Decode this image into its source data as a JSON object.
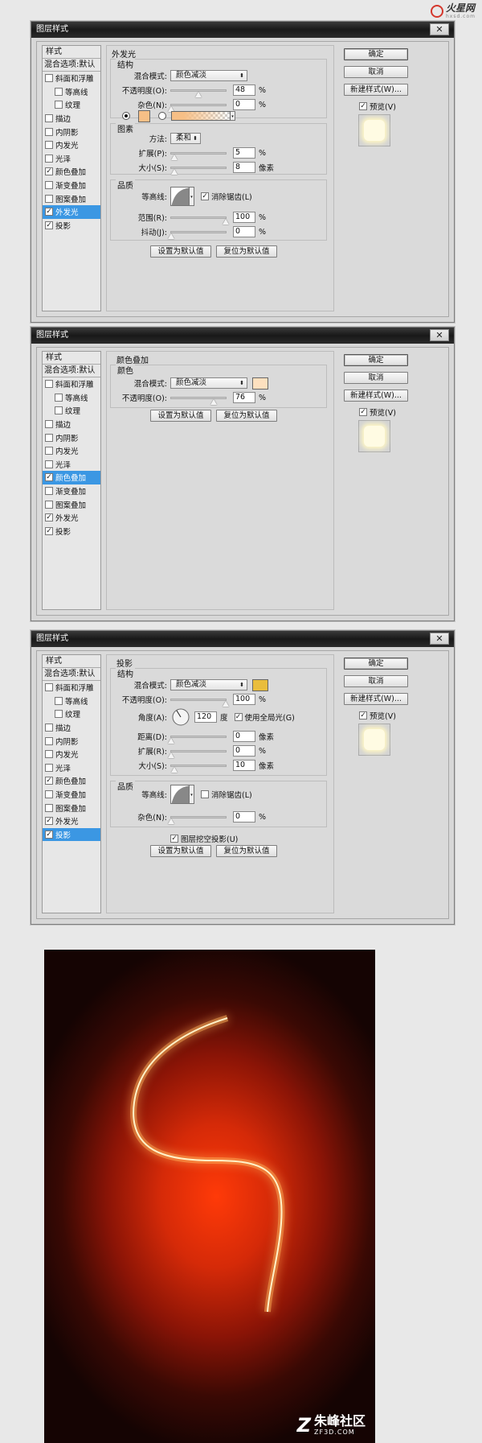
{
  "watermark_top": {
    "name": "火星网",
    "sub": "hxsd.com"
  },
  "dialog1": {
    "title": "图层样式",
    "styles_header": "样式",
    "blend_label": "混合选项:默认",
    "items": [
      {
        "label": "斜面和浮雕",
        "checked": false
      },
      {
        "label": "等高线",
        "checked": false,
        "indent": true
      },
      {
        "label": "纹理",
        "checked": false,
        "indent": true
      },
      {
        "label": "描边",
        "checked": false
      },
      {
        "label": "内阴影",
        "checked": false
      },
      {
        "label": "内发光",
        "checked": false
      },
      {
        "label": "光泽",
        "checked": false
      },
      {
        "label": "颜色叠加",
        "checked": true
      },
      {
        "label": "渐变叠加",
        "checked": false
      },
      {
        "label": "图案叠加",
        "checked": false
      },
      {
        "label": "外发光",
        "checked": true,
        "active": true
      },
      {
        "label": "投影",
        "checked": true
      }
    ],
    "panel_title": "外发光",
    "structure": {
      "title": "结构",
      "blend_mode_label": "混合模式:",
      "blend_mode_value": "颜色减淡",
      "opacity_label": "不透明度(O):",
      "opacity_value": "48",
      "noise_label": "杂色(N):",
      "noise_value": "0",
      "percent": "%",
      "color": "#f7bf86"
    },
    "elements": {
      "title": "图素",
      "method_label": "方法:",
      "method_value": "柔和",
      "spread_label": "扩展(P):",
      "spread_value": "5",
      "size_label": "大小(S):",
      "size_value": "8",
      "percent": "%",
      "px": "像素"
    },
    "quality": {
      "title": "品质",
      "contour_label": "等高线:",
      "antialias_label": "消除锯齿(L)",
      "range_label": "范围(R):",
      "range_value": "100",
      "jitter_label": "抖动(J):",
      "jitter_value": "0",
      "percent": "%"
    },
    "set_default": "设置为默认值",
    "reset_default": "复位为默认值",
    "ok": "确定",
    "cancel": "取消",
    "new_style": "新建样式(W)...",
    "preview": "预览(V)"
  },
  "dialog2": {
    "title": "图层样式",
    "styles_header": "样式",
    "blend_label": "混合选项:默认",
    "items": [
      {
        "label": "斜面和浮雕",
        "checked": false
      },
      {
        "label": "等高线",
        "checked": false,
        "indent": true
      },
      {
        "label": "纹理",
        "checked": false,
        "indent": true
      },
      {
        "label": "描边",
        "checked": false
      },
      {
        "label": "内阴影",
        "checked": false
      },
      {
        "label": "内发光",
        "checked": false
      },
      {
        "label": "光泽",
        "checked": false
      },
      {
        "label": "颜色叠加",
        "checked": true,
        "active": true
      },
      {
        "label": "渐变叠加",
        "checked": false
      },
      {
        "label": "图案叠加",
        "checked": false
      },
      {
        "label": "外发光",
        "checked": true
      },
      {
        "label": "投影",
        "checked": true
      }
    ],
    "panel_title": "颜色叠加",
    "color_section": "颜色",
    "blend_mode_label": "混合模式:",
    "blend_mode_value": "颜色减淡",
    "opacity_label": "不透明度(O):",
    "opacity_value": "76",
    "percent": "%",
    "color": "#fde0bf",
    "set_default": "设置为默认值",
    "reset_default": "复位为默认值",
    "ok": "确定",
    "cancel": "取消",
    "new_style": "新建样式(W)...",
    "preview": "预览(V)"
  },
  "dialog3": {
    "title": "图层样式",
    "styles_header": "样式",
    "blend_label": "混合选项:默认",
    "items": [
      {
        "label": "斜面和浮雕",
        "checked": false
      },
      {
        "label": "等高线",
        "checked": false,
        "indent": true
      },
      {
        "label": "纹理",
        "checked": false,
        "indent": true
      },
      {
        "label": "描边",
        "checked": false
      },
      {
        "label": "内阴影",
        "checked": false
      },
      {
        "label": "内发光",
        "checked": false
      },
      {
        "label": "光泽",
        "checked": false
      },
      {
        "label": "颜色叠加",
        "checked": true
      },
      {
        "label": "渐变叠加",
        "checked": false
      },
      {
        "label": "图案叠加",
        "checked": false
      },
      {
        "label": "外发光",
        "checked": true
      },
      {
        "label": "投影",
        "checked": true,
        "active": true
      }
    ],
    "panel_title": "投影",
    "structure": {
      "title": "结构",
      "blend_mode_label": "混合模式:",
      "blend_mode_value": "颜色减淡",
      "opacity_label": "不透明度(O):",
      "opacity_value": "100",
      "angle_label": "角度(A):",
      "angle_value": "120",
      "degree": "度",
      "global_light_label": "使用全局光(G)",
      "distance_label": "距离(D):",
      "distance_value": "0",
      "spread_label": "扩展(R):",
      "spread_value": "0",
      "size_label": "大小(S):",
      "size_value": "10",
      "percent": "%",
      "px": "像素",
      "color": "#e9bd3c"
    },
    "quality": {
      "title": "品质",
      "contour_label": "等高线:",
      "antialias_label": "消除锯齿(L)",
      "noise_label": "杂色(N):",
      "noise_value": "0",
      "percent": "%"
    },
    "knockout_label": "图层挖空投影(U)",
    "set_default": "设置为默认值",
    "reset_default": "复位为默认值",
    "ok": "确定",
    "cancel": "取消",
    "new_style": "新建样式(W)...",
    "preview": "预览(V)"
  },
  "watermark_bottom": {
    "title": "朱峰社区",
    "sub": "ZF3D.COM"
  }
}
